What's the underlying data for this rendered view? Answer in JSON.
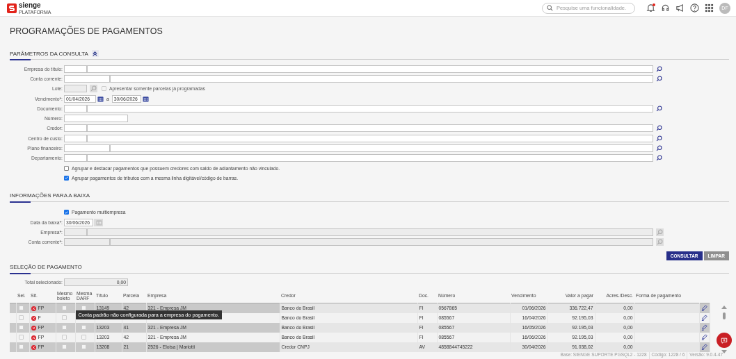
{
  "header": {
    "logo": "sienge",
    "logo_sub": "PLATAFORMA",
    "search_placeholder": "Pesquise uma funcionalidade.",
    "notification_unread": true,
    "avatar": "DF"
  },
  "page_title": "PROGRAMAÇÕES DE PAGAMENTOS",
  "consulta": {
    "title": "PARÂMETROS DA CONSULTA",
    "expanded": true,
    "fields": [
      {
        "kind": "lookup",
        "label": "Empresa do título:",
        "disabled": false
      },
      {
        "kind": "lookup-wide",
        "label": "Conta corrente:",
        "disabled": false
      },
      {
        "kind": "lote",
        "label": "Lote:",
        "disabled": true,
        "checkbox": {
          "label": "Apresentar somente parcelas já programadas",
          "checked": false,
          "disabled": true
        }
      },
      {
        "kind": "date-range",
        "label": "Vencimento*:",
        "from": "01/04/2026",
        "separator": "a",
        "to": "30/06/2026"
      },
      {
        "kind": "lookup",
        "label": "Documento:",
        "disabled": false
      },
      {
        "kind": "text",
        "label": "Número:"
      },
      {
        "kind": "lookup",
        "label": "Credor:",
        "disabled": false
      },
      {
        "kind": "lookup",
        "label": "Centro de custo:",
        "disabled": false
      },
      {
        "kind": "lookup-wide",
        "label": "Plano financeiro:",
        "disabled": false
      },
      {
        "kind": "lookup",
        "label": "Departamento:",
        "disabled": false
      }
    ],
    "checkboxes": [
      {
        "label": "Agrupar e destacar pagamentos que possuem credores com saldo de adiantamento não vinculado.",
        "checked": false
      },
      {
        "label": "Agrupar pagamentos de tributos com a mesma linha digitável/código de barras.",
        "checked": true
      }
    ]
  },
  "baixa": {
    "title": "INFORMAÇÕES PARA A BAIXA",
    "checkbox": {
      "label": "Pagamento multiempresa",
      "checked": true
    },
    "fields": [
      {
        "kind": "date",
        "label": "Data da baixa*:",
        "value": "30/06/2026",
        "calendar_disabled": true
      },
      {
        "kind": "lookup",
        "label": "Empresa*:",
        "disabled": true
      },
      {
        "kind": "lookup-wide",
        "label": "Conta corrente*:",
        "disabled": true
      }
    ]
  },
  "buttons": [
    {
      "label": "CONSULTAR",
      "disabled": false
    },
    {
      "label": "LIMPAR",
      "disabled": true
    }
  ],
  "selecao": {
    "title": "SELEÇÃO DE PAGAMENTO",
    "total_label": "Total selecionado:",
    "total_value": "0,00",
    "columns": [
      "Sel.",
      "Sit.",
      "Mesmo boleto",
      "Mesma DARF",
      "Título",
      "Parcela",
      "Empresa",
      "Credor",
      "Doc.",
      "Número",
      "Vencimento",
      "Valor a pagar",
      "Acres./Desc.",
      "Forma de pagamento"
    ],
    "rows": [
      {
        "checked": false,
        "sit": "FP",
        "mesmo_boleto": false,
        "mesma_darf": false,
        "titulo": "13149",
        "parcela": "42",
        "empresa": "321 - Empresa JM",
        "credor": "Banco do Brasil",
        "doc": "FI",
        "numero": "0567865",
        "vencimento": "01/06/2026",
        "valor": "336.722,47",
        "acres": "0,00"
      },
      {
        "checked": false,
        "sit": "F",
        "mesmo_boleto": false,
        "credor": "Banco do Brasil",
        "doc": "FI",
        "numero": "085567",
        "vencimento": "16/04/2026",
        "valor": "92.195,03",
        "acres": "0,00",
        "tooltip": "Conta padrão não configurada para a empresa do pagamento."
      },
      {
        "checked": false,
        "sit": "FP",
        "mesmo_boleto": false,
        "mesma_darf": false,
        "titulo": "13203",
        "parcela": "41",
        "empresa": "321 - Empresa JM",
        "credor": "Banco do Brasil",
        "doc": "FI",
        "numero": "085567",
        "vencimento": "16/05/2026",
        "valor": "92.195,03",
        "acres": "0,00"
      },
      {
        "checked": false,
        "sit": "FP",
        "mesmo_boleto": false,
        "mesma_darf": false,
        "titulo": "13203",
        "parcela": "42",
        "empresa": "321 - Empresa JM",
        "credor": "Banco do Brasil",
        "doc": "FI",
        "numero": "085567",
        "vencimento": "16/06/2026",
        "valor": "92.195,03",
        "acres": "0,00"
      },
      {
        "checked": false,
        "sit": "FP",
        "mesmo_boleto": false,
        "mesma_darf": false,
        "titulo": "13208",
        "parcela": "21",
        "empresa": "2526 - Eloisa | Mariotti",
        "credor": "Credor CNPJ",
        "doc": "AV",
        "numero": "4858844745222",
        "vencimento": "30/04/2026",
        "valor": "91.038,02",
        "acres": "0,00"
      }
    ]
  },
  "status_bar": [
    "Base: SIENGE SUPORTE PGSQL2 - 1228",
    "Código: 1228 / 6",
    "Versão: 9.0.4-47"
  ]
}
